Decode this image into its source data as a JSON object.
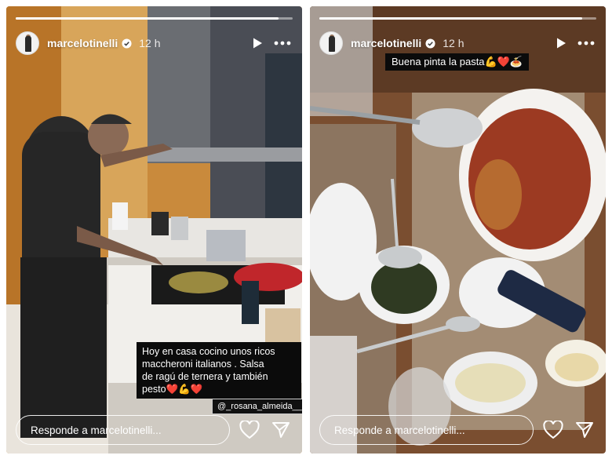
{
  "stories": [
    {
      "username": "marcelotinelli",
      "time": "12 h",
      "progress": 0.95,
      "caption_lines": [
        "Hoy en casa cocino unos ricos",
        "maccheroni italianos . Salsa",
        "de ragú de ternera y también",
        "pesto"
      ],
      "caption_emojis": "❤️💪❤️",
      "mention": "@_rosana_almeida__",
      "reply_placeholder": "Responde a marcelotinelli..."
    },
    {
      "username": "marcelotinelli",
      "time": "12 h",
      "progress": 0.95,
      "caption": "Buena pinta la pasta💪❤️🍝",
      "reply_placeholder": "Responde a marcelotinelli..."
    }
  ],
  "icons": {
    "verified": "verified-badge-icon",
    "play": "play-icon",
    "more": "more-options-icon",
    "like": "heart-icon",
    "share": "send-icon"
  },
  "colors": {
    "verified_blue": "#3897f0",
    "caption_bg": "#0b0b0b",
    "heart_red": "#e0245e"
  }
}
